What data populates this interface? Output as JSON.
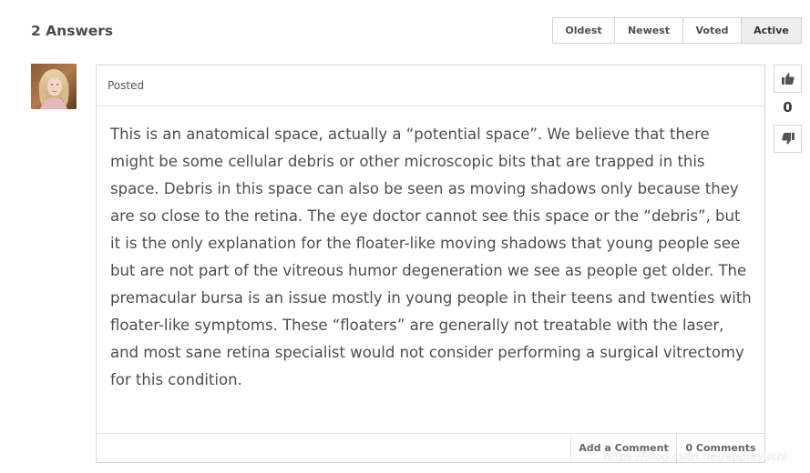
{
  "answers": {
    "title": "2 Answers"
  },
  "sort": {
    "tabs": [
      {
        "label": "Oldest"
      },
      {
        "label": "Newest"
      },
      {
        "label": "Voted"
      },
      {
        "label": "Active"
      }
    ],
    "selected": "Active"
  },
  "answer": {
    "posted_label": "Posted",
    "body": "This is an anatomical space, actually a “potential space”. We believe that there might be some cellular debris or other microscopic bits that are trapped in this space. Debris in this space can also be seen as moving shadows only because they are so close to the retina. The eye doctor cannot see this space or the “debris”, but it is the only explanation for the floater-like moving shadows that young people see but are not part of the vitreous humor degeneration we see as people get older. The premacular bursa is an issue mostly in young people in their teens and twenties with floater-like symptoms. These “floaters” are generally not treatable with the laser, and most sane retina specialist would not consider performing a surgical vitrectomy for this condition.",
    "add_comment_label": "Add a Comment",
    "comments_label": "0 Comments"
  },
  "vote": {
    "count": "0",
    "up_icon": "thumbs-up-icon",
    "down_icon": "thumbs-down-icon"
  },
  "watermark": "https://blog.csdn.net/appleyuchi"
}
